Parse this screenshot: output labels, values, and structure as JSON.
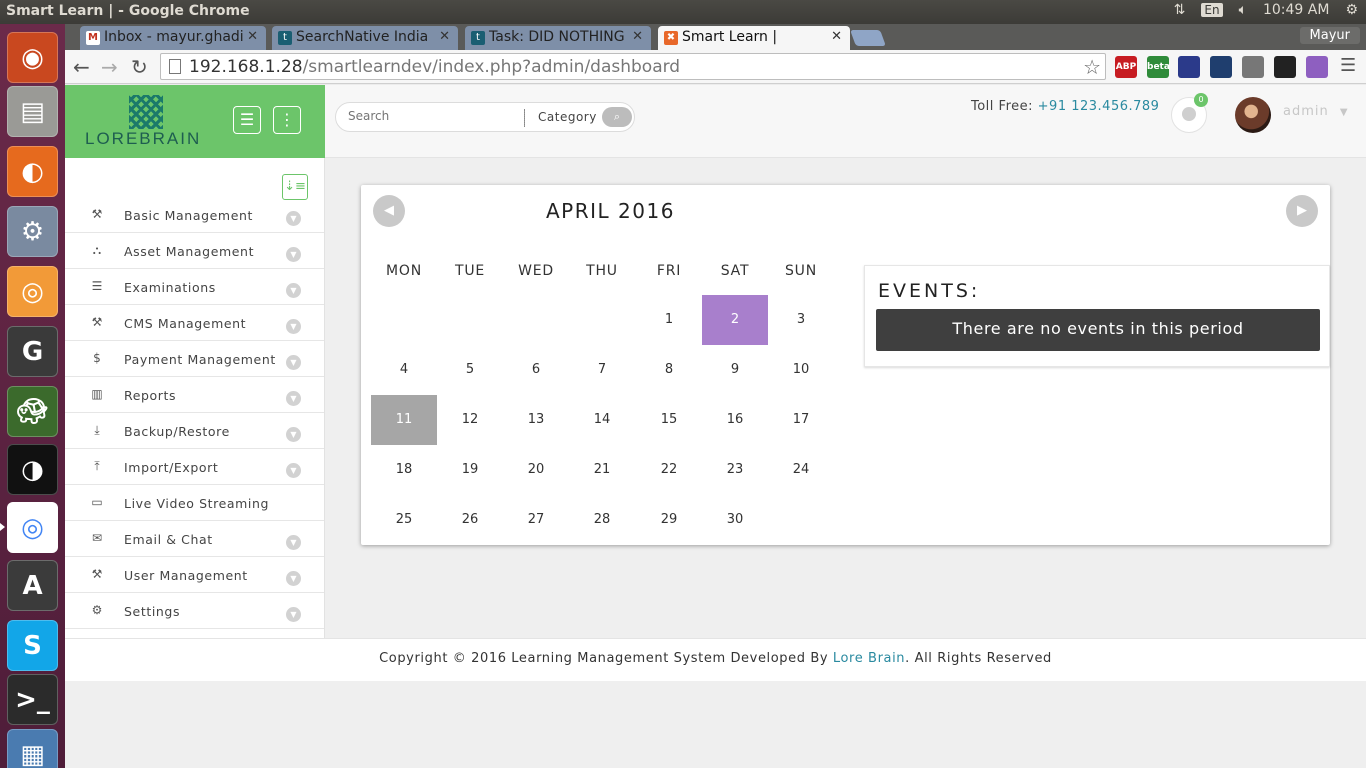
{
  "os": {
    "window_title": "Smart Learn | - Google Chrome",
    "lang": "En",
    "clock": "10:49 AM"
  },
  "launcher": [
    "ubuntu-dash-icon",
    "files-icon",
    "firefox-icon",
    "settings-icon",
    "sublime-icon",
    "git-icon",
    "turtle-icon",
    "inkscape-icon",
    "chrome-icon",
    "software-center-icon",
    "skype-icon",
    "terminal-icon",
    "workspace-icon"
  ],
  "browser": {
    "tabs": [
      {
        "label": "Inbox - mayur.ghadi",
        "icon": "gmail-icon",
        "color": "#c23321"
      },
      {
        "label": "SearchNative India",
        "icon": "trello-icon",
        "color": "#1a5e72"
      },
      {
        "label": "Task: DID NOTHING",
        "icon": "trello-icon",
        "color": "#1a5e72"
      },
      {
        "label": "Smart Learn |",
        "icon": "xampp-icon",
        "color": "#e8682a"
      }
    ],
    "profile": "Mayur",
    "url_host": "192.168.1.28",
    "url_path": "/smartlearndev/index.php?admin/dashboard",
    "extensions": [
      {
        "label": "ABP",
        "color": "#c71c22"
      },
      {
        "label": "beta",
        "color": "#2f8b3a"
      },
      {
        "label": "",
        "color": "#2b3a8a"
      },
      {
        "label": "",
        "color": "#1f3e6e"
      },
      {
        "label": "",
        "color": "#777777"
      },
      {
        "label": "",
        "color": "#222222"
      },
      {
        "label": "",
        "color": "#8e5fc0"
      }
    ]
  },
  "app": {
    "brand": "LOREBRAIN",
    "search_placeholder": "Search",
    "category_label": "Category",
    "toll_label": "Toll Free:",
    "toll_number": "+91 123.456.789",
    "notif_count": "0",
    "user_name": "admin",
    "menu": [
      {
        "label": "Basic Management",
        "icon": "tools-icon",
        "glyph": "⚒",
        "chevron": true
      },
      {
        "label": "Asset Management",
        "icon": "sitemap-icon",
        "glyph": "⛬",
        "chevron": true
      },
      {
        "label": "Examinations",
        "icon": "list-icon",
        "glyph": "☰",
        "chevron": true
      },
      {
        "label": "CMS Management",
        "icon": "tools-icon",
        "glyph": "⚒",
        "chevron": true
      },
      {
        "label": "Payment Management",
        "icon": "dollar-icon",
        "glyph": "$",
        "chevron": true
      },
      {
        "label": "Reports",
        "icon": "bar-chart-icon",
        "glyph": "▥",
        "chevron": true
      },
      {
        "label": "Backup/Restore",
        "icon": "download-icon",
        "glyph": "⤓",
        "chevron": true
      },
      {
        "label": "Import/Export",
        "icon": "upload-icon",
        "glyph": "⤒",
        "chevron": true
      },
      {
        "label": "Live Video Streaming",
        "icon": "monitor-icon",
        "glyph": "▭",
        "chevron": false
      },
      {
        "label": "Email & Chat",
        "icon": "envelope-icon",
        "glyph": "✉",
        "chevron": true
      },
      {
        "label": "User Management",
        "icon": "tools-icon",
        "glyph": "⚒",
        "chevron": true
      },
      {
        "label": "Settings",
        "icon": "cogs-icon",
        "glyph": "⚙",
        "chevron": true
      }
    ],
    "calendar": {
      "title": "APRIL 2016",
      "weekdays": [
        "MON",
        "TUE",
        "WED",
        "THU",
        "FRI",
        "SAT",
        "SUN"
      ],
      "weeks": [
        [
          "",
          "",
          "",
          "",
          "1",
          "2",
          "3"
        ],
        [
          "4",
          "5",
          "6",
          "7",
          "8",
          "9",
          "10"
        ],
        [
          "11",
          "12",
          "13",
          "14",
          "15",
          "16",
          "17"
        ],
        [
          "18",
          "19",
          "20",
          "21",
          "22",
          "23",
          "24"
        ],
        [
          "25",
          "26",
          "27",
          "28",
          "29",
          "30",
          ""
        ]
      ],
      "selected_day": "2",
      "today": "11",
      "selected_color": "#a87fcc",
      "today_color": "#a6a6a6"
    },
    "events": {
      "title": "EVENTS:",
      "empty_text": "There are no events in this period"
    },
    "footer": {
      "prefix": "Copyright © 2016 Learning Management System Developed By",
      "link": "Lore Brain",
      "suffix": ". All Rights Reserved"
    }
  }
}
